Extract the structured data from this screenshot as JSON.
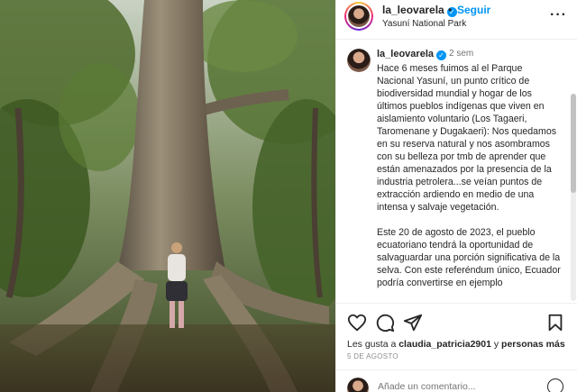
{
  "photo": {
    "alt_icon": "forest-photo"
  },
  "header": {
    "username": "la_leovarela",
    "verified_icon": "verified-badge-icon",
    "separator": "•",
    "follow_label": "Seguir",
    "location": "Yasuní National Park",
    "more_icon": "more-options-icon"
  },
  "caption": {
    "username": "la_leovarela",
    "time": "2 sem",
    "text": "Hace 6 meses fuimos al el Parque Nacional Yasuní, un punto crítico de biodiversidad mundial y hogar de los últimos pueblos indígenas que viven en aislamiento voluntario (Los Tagaeri, Taromenane y Dugakaeri): Nos quedamos en su reserva natural y nos asombramos con su belleza por tmb de aprender que están amenazados por la presencia de la industria petrolera...se veían puntos de extracción ardiendo en medio de una intensa y salvaje vegetación.\n\nEste 20 de agosto de 2023, el pueblo ecuatoriano tendrá  la oportunidad de salvaguardar una porción significativa de la selva. Con este referéndum único, Ecuador podría convertirse en ejemplo"
  },
  "actions": {
    "like_icon": "heart-icon",
    "comment_icon": "comment-icon",
    "share_icon": "share-icon",
    "save_icon": "bookmark-icon"
  },
  "likes": {
    "prefix": "Les gusta a ",
    "user": "claudia_patricia2901",
    "middle": " y ",
    "others": "personas más"
  },
  "date": "5 DE AGOSTO",
  "comment": {
    "placeholder": "Añade un comentario...",
    "emoji_icon": "emoji-icon"
  },
  "colors": {
    "accent": "#0095f6",
    "text": "#262626",
    "muted": "#737373"
  }
}
